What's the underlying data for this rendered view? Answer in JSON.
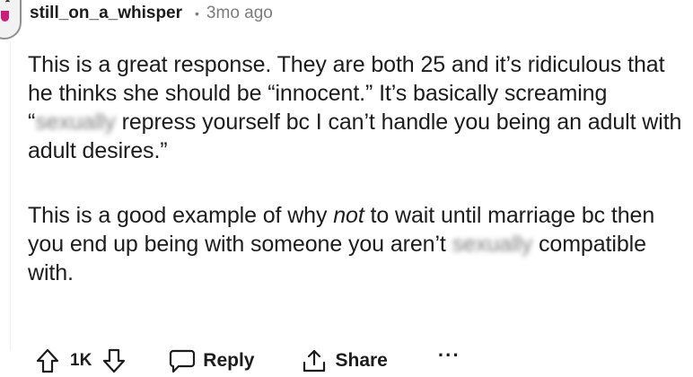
{
  "comment": {
    "username": "still_on_a_whisper",
    "separator": "•",
    "timestamp": "3mo ago",
    "paragraph1": {
      "before_blur": "This is a great response. They are both 25 and it’s ridiculous that he thinks she should be “innocent.” It’s basically screaming “",
      "blurred": "sexually",
      "after_blur": " repress yourself bc I can’t handle you being an adult with adult desires.”"
    },
    "paragraph2": {
      "before_em": "This is a good example of why ",
      "em": "not",
      "after_em": " to wait until marriage bc then you end up being with someone you aren’t ",
      "blurred": "sexually",
      "after_blur": " compatible with."
    }
  },
  "actions": {
    "vote_count": "1K",
    "reply_label": "Reply",
    "share_label": "Share",
    "more_label": "···"
  },
  "icons": {
    "upvote": "arrow-up-outline-icon",
    "downvote": "arrow-down-outline-icon",
    "reply": "speech-bubble-icon",
    "share": "share-upload-icon",
    "more": "ellipsis-icon"
  },
  "colors": {
    "text": "#1c1c1c",
    "meta": "#7c7c7c"
  }
}
